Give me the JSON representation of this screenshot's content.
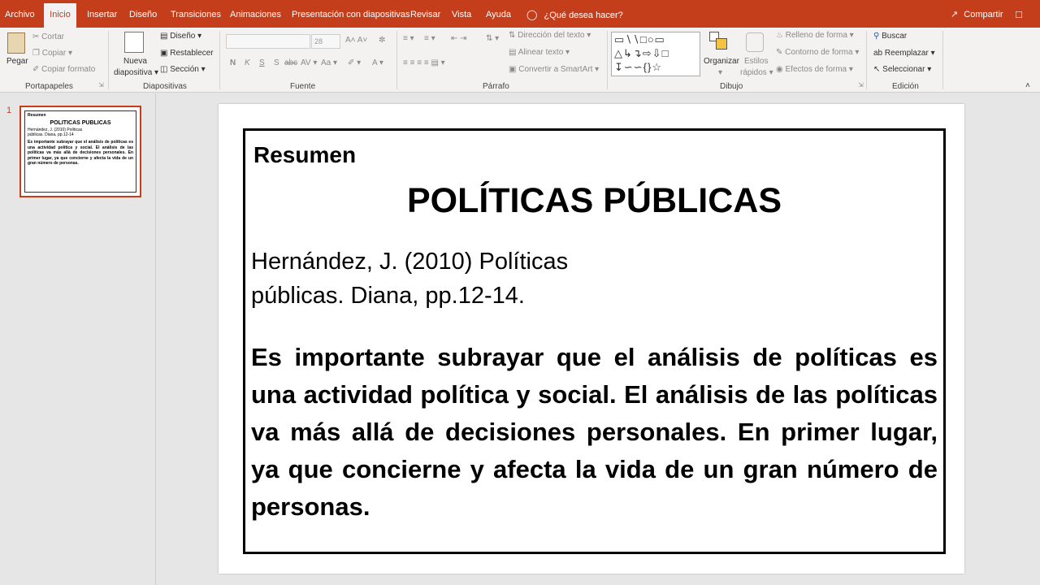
{
  "tabs": {
    "archivo": "Archivo",
    "inicio": "Inicio",
    "insertar": "Insertar",
    "diseno": "Diseño",
    "transiciones": "Transiciones",
    "animaciones": "Animaciones",
    "presentacion": "Presentación con diapositivas",
    "revisar": "Revisar",
    "vista": "Vista",
    "ayuda": "Ayuda",
    "tell_me": "¿Qué desea hacer?",
    "share": "Compartir"
  },
  "ribbon": {
    "portapapeles": {
      "label": "Portapapeles",
      "pegar": "Pegar",
      "cortar": "Cortar",
      "copiar": "Copiar",
      "copiar_formato": "Copiar formato"
    },
    "diapositivas": {
      "label": "Diapositivas",
      "nueva": "Nueva",
      "diapositiva": "diapositiva",
      "diseno": "Diseño",
      "restablecer": "Restablecer",
      "seccion": "Sección"
    },
    "fuente": {
      "label": "Fuente",
      "size": "28"
    },
    "parrafo": {
      "label": "Párrafo",
      "direccion": "Dirección del texto",
      "alinear": "Alinear texto",
      "smartart": "Convertir a SmartArt"
    },
    "dibujo": {
      "label": "Dibujo",
      "organizar": "Organizar",
      "estilos": "Estilos",
      "rapidos": "rápidos",
      "relleno": "Relleno de forma",
      "contorno": "Contorno de forma",
      "efectos": "Efectos de forma"
    },
    "edicion": {
      "label": "Edición",
      "buscar": "Buscar",
      "reemplazar": "Reemplazar",
      "seleccionar": "Seleccionar"
    }
  },
  "thumbnail": {
    "number": "1",
    "resumen": "Resumen",
    "title": "POLITICAS PUBLICAS",
    "ref": "Hernández, J. (2010) Políticas públicas. Diana, pp.12-14",
    "body": "Es importante subrayar que el análisis de políticas es una actividad política y social. El análisis de las políticas va más allá de decisiones personales. En primer lugar, ya que concierne y afecta la vida de un gran número de personas."
  },
  "slide": {
    "resumen": "Resumen",
    "title": "POLÍTICAS PÚBLICAS",
    "ref_line1": "Hernández, J. (2010) Políticas",
    "ref_line2": "públicas. Diana, pp.12-14.",
    "body": "Es importante subrayar que el análisis de políticas es una actividad política y social. El análisis de las políticas va más allá de decisiones personales. En primer lugar, ya que concierne y afecta la vida de un gran número de personas."
  },
  "colors": {
    "accent": "#c43e1c",
    "ribbon": "#f3f2f1"
  }
}
